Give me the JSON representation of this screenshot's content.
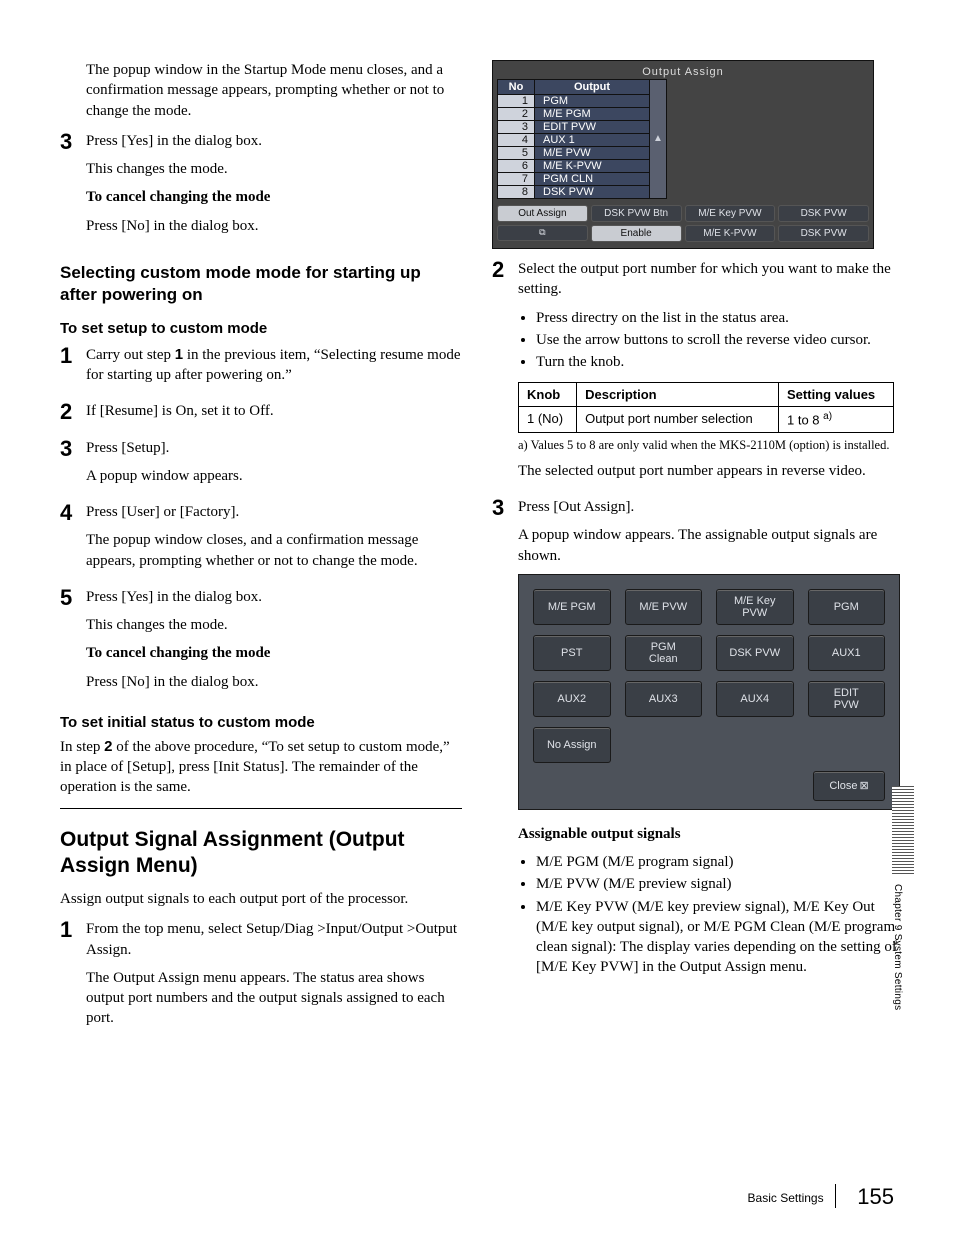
{
  "page_number": "155",
  "footer_label": "Basic Settings",
  "side_tab": "Chapter 9  System Settings",
  "left": {
    "intro_p1": "The popup window in the Startup Mode menu closes, and a confirmation message appears, prompting whether or not to change the mode.",
    "step3_a": "Press [Yes] in the dialog box.",
    "step3_b": "This changes the mode.",
    "cancel_h": "To cancel changing the mode",
    "cancel_p": "Press [No] in the dialog box.",
    "sec1_h": "Selecting custom mode mode for starting up after powering on",
    "sec1_sub": "To set setup to custom mode",
    "s1": "Carry out step 1 in the previous item, “Selecting resume mode for starting up after powering on.”",
    "s2": "If [Resume] is On, set it to Off.",
    "s3": "Press [Setup].",
    "s3b": "A popup window appears.",
    "s4": "Press [User] or [Factory].",
    "s4b": "The popup window closes, and a confirmation message appears, prompting whether or not to change the mode.",
    "s5": "Press [Yes] in the dialog box.",
    "s5b": "This changes the mode.",
    "cancel2_h": "To cancel changing the mode",
    "cancel2_p": "Press [No] in the dialog box.",
    "sec2_sub": "To set initial status to custom mode",
    "sec2_p": "In step 2 of the above procedure, “To set setup to custom mode,” in place of [Setup], press [Init Status]. The remainder of the operation is the same.",
    "major_h": "Output Signal Assignment (Output Assign Menu)",
    "major_p": "Assign output signals to each output port of the processor.",
    "m1a": "From the top menu, select Setup/Diag >Input/Output >Output Assign.",
    "m1b": "The Output Assign menu appears. The status area shows output port numbers and the output signals assigned to each port."
  },
  "oas": {
    "title": "Output Assign",
    "head_no": "No",
    "head_out": "Output",
    "rows": [
      {
        "no": "1",
        "out": "PGM"
      },
      {
        "no": "2",
        "out": "M/E PGM"
      },
      {
        "no": "3",
        "out": "EDIT PVW"
      },
      {
        "no": "4",
        "out": "AUX 1"
      },
      {
        "no": "5",
        "out": "M/E PVW"
      },
      {
        "no": "6",
        "out": "M/E K-PVW"
      },
      {
        "no": "7",
        "out": "PGM CLN"
      },
      {
        "no": "8",
        "out": "DSK PVW"
      }
    ],
    "btns": {
      "out_assign": "Out Assign",
      "dsk_pvw_btn": "DSK PVW Btn",
      "me_key_pvw": "M/E Key PVW",
      "dsk_pvw": "DSK PVW",
      "enable": "Enable",
      "me_k_pvw": "M/E K-PVW",
      "dsk_pvw2": "DSK PVW"
    }
  },
  "right": {
    "s2a": "Select the output port number for which you want to make the setting.",
    "b1": "Press directry on the list in the status area.",
    "b2": "Use the arrow buttons to scroll the reverse video cursor.",
    "b3": "Turn the knob.",
    "knob_h1": "Knob",
    "knob_h2": "Description",
    "knob_h3": "Setting values",
    "knob_c1": "1 (No)",
    "knob_c2": "Output port number selection",
    "knob_c3": "1 to 8 ",
    "knob_sup": "a)",
    "fn_a": "a) Values 5 to 8 are only valid when the MKS-2110M (option) is installed.",
    "s2b": "The selected output port number appears in reverse video.",
    "s3a": "Press [Out Assign].",
    "s3b": "A popup window appears. The assignable output signals are shown.",
    "popup": [
      "M/E PGM",
      "M/E PVW",
      "M/E Key PVW",
      "PGM",
      "PST",
      "PGM Clean",
      "DSK PVW",
      "AUX1",
      "AUX2",
      "AUX3",
      "AUX4",
      "EDIT PVW",
      "No Assign"
    ],
    "popup_close": "Close",
    "aos_h": "Assignable output signals",
    "aos1": "M/E PGM (M/E program signal)",
    "aos2": "M/E PVW (M/E preview signal)",
    "aos3": "M/E Key PVW (M/E key preview signal), M/E Key Out (M/E key output signal), or M/E PGM Clean (M/E program clean signal): The display varies depending on the setting of [M/E Key PVW] in the Output Assign menu."
  }
}
